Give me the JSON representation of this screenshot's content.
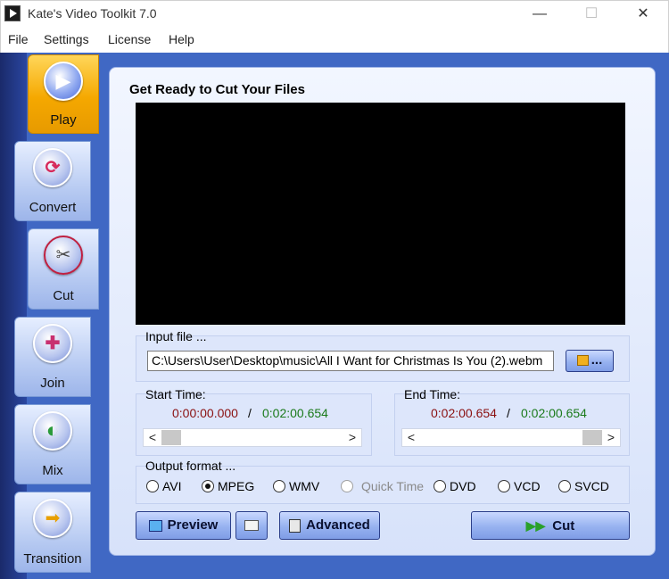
{
  "window": {
    "title": "Kate's Video Toolkit 7.0",
    "minimize": "—",
    "maximize": "☐",
    "close": "✕"
  },
  "menu": [
    "File",
    "Settings",
    "License",
    "Help"
  ],
  "tabs": [
    {
      "label": "Play",
      "icon": "play-icon",
      "glyph": "▶"
    },
    {
      "label": "Convert",
      "icon": "convert-icon",
      "glyph": "⟳"
    },
    {
      "label": "Cut",
      "icon": "scissors-icon",
      "glyph": "✂"
    },
    {
      "label": "Join",
      "icon": "puzzle-icon",
      "glyph": "✚"
    },
    {
      "label": "Mix",
      "icon": "mix-icon",
      "glyph": "◐"
    },
    {
      "label": "Transition",
      "icon": "arrow-right-icon",
      "glyph": "➡"
    }
  ],
  "main": {
    "title": "Get Ready to Cut Your Files",
    "input_file_label": "Input file ...",
    "input_file_value": "C:\\Users\\User\\Desktop\\music\\All I Want for Christmas Is You (2).webm",
    "browse_label": "...",
    "start_time_label": "Start Time:",
    "start_time": "0:00:00.000",
    "start_total": "0:02:00.654",
    "end_time_label": "End Time:",
    "end_time": "0:02:00.654",
    "end_total": "0:02:00.654",
    "separator": "/",
    "start_slider_position": 0.0,
    "end_slider_position": 1.0,
    "output_format_label": "Output format ...",
    "formats": [
      "AVI",
      "MPEG",
      "WMV",
      "Quick Time",
      "DVD",
      "VCD",
      "SVCD"
    ],
    "selected_format": "MPEG",
    "disabled_format": "Quick Time",
    "preview_label": "Preview",
    "advanced_label": "Advanced",
    "cut_label": "Cut"
  },
  "colors": {
    "accent_active_tab": "#f5a800",
    "panel_bg": "#dde6fb",
    "client_bg": "#4068c4",
    "time_red": "#8a1010",
    "time_green": "#1a7a1a"
  }
}
